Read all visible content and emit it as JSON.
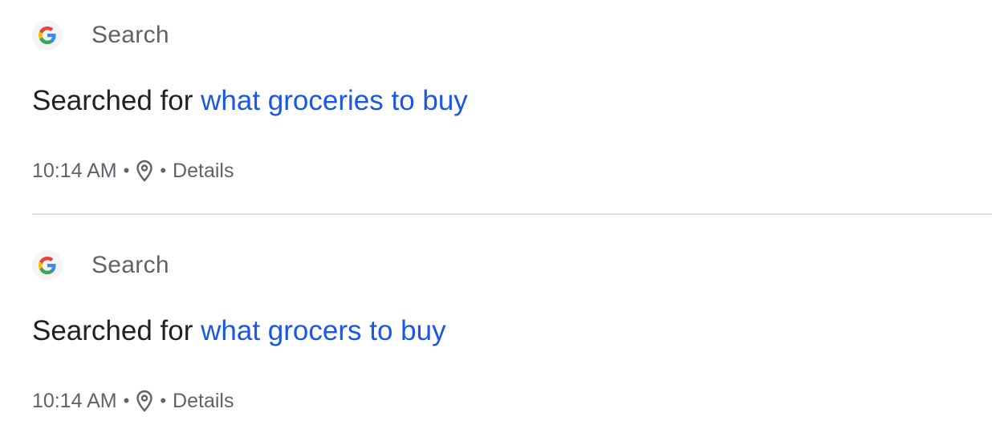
{
  "entries": [
    {
      "product": "Search",
      "title_prefix": "Searched for",
      "query": "what groceries to buy",
      "time": "10:14 AM",
      "separator": "•",
      "details": "Details"
    },
    {
      "product": "Search",
      "title_prefix": "Searched for",
      "query": "what grocers to buy",
      "time": "10:14 AM",
      "separator": "•",
      "details": "Details"
    }
  ],
  "colors": {
    "link": "#1a56e8",
    "text": "#202124",
    "secondary": "#5f6368",
    "divider": "#dadce0"
  },
  "icons": [
    "google-g-icon",
    "location-pin-icon"
  ]
}
